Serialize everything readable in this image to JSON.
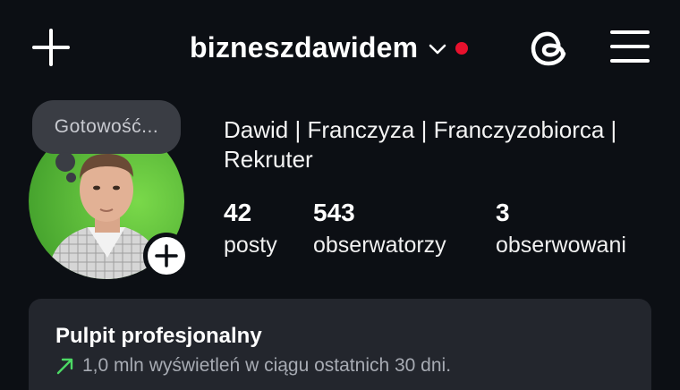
{
  "header": {
    "username": "bizneszdawidem",
    "notification_dot_color": "#e8112d",
    "icons": [
      "plus-icon",
      "chevron-down-icon",
      "threads-icon",
      "hamburger-menu-icon"
    ]
  },
  "profile": {
    "note": "Gotowość...",
    "full_name": "Dawid | Franczyza | Franczyzobiorca | Rekruter",
    "stats": {
      "posts": {
        "value": "42",
        "label": "posty"
      },
      "followers": {
        "value": "543",
        "label": "obserwatorzy"
      },
      "following": {
        "value": "3",
        "label": "obserwowani"
      }
    }
  },
  "dashboard": {
    "title": "Pulpit profesjonalny",
    "subtitle": "1,0 mln wyświetleń w ciągu ostatnich 30 dni.",
    "trend_color": "#4cd964"
  }
}
